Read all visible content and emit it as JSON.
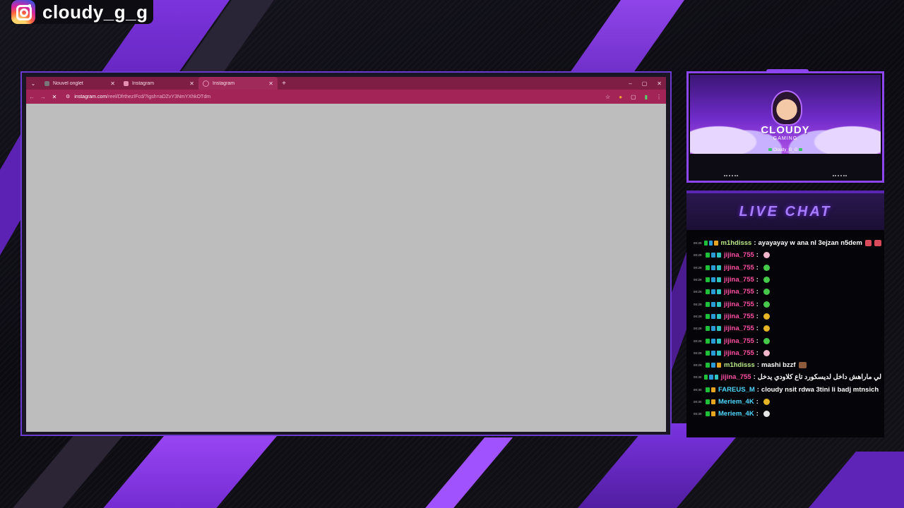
{
  "instagram": {
    "handle": "cloudy_g_g"
  },
  "browser": {
    "tabs": [
      {
        "label": "Nouvel onglet",
        "active": false
      },
      {
        "label": "Instagram",
        "active": false
      },
      {
        "label": "Instagram",
        "active": true
      }
    ],
    "new_tab_label": "+",
    "url_host": "instagram.com",
    "url_path": "/reel/DfrthezIFcd/?igsh=aDZvY3NmYXhkOTdm",
    "window_controls": [
      "–",
      "▢",
      "✕"
    ]
  },
  "webcam": {
    "logo_main": "CLOUDY",
    "logo_sub": "GAMING",
    "handle": "Cloudy_G_G"
  },
  "chat": {
    "title": "LIVE CHAT",
    "messages": [
      {
        "time": "00:29",
        "badges": [
          "g",
          "c",
          "y"
        ],
        "user": "m1hdisss",
        "color": "#b8e986",
        "text": "ayayayay w ana nl 3ejzan n5dem",
        "emotes": [
          "red",
          "red"
        ]
      },
      {
        "time": "00:29",
        "badges": [
          "g",
          "c",
          "t"
        ],
        "user": "jijina_755",
        "color": "#ff4fa3",
        "text": "",
        "emotes": [
          "pink"
        ]
      },
      {
        "time": "00:29",
        "badges": [
          "g",
          "c",
          "t"
        ],
        "user": "jijina_755",
        "color": "#ff4fa3",
        "text": "",
        "emotes": [
          "green"
        ]
      },
      {
        "time": "00:29",
        "badges": [
          "g",
          "c",
          "t"
        ],
        "user": "jijina_755",
        "color": "#ff4fa3",
        "text": "",
        "emotes": [
          "green"
        ]
      },
      {
        "time": "00:29",
        "badges": [
          "g",
          "c",
          "t"
        ],
        "user": "jijina_755",
        "color": "#ff4fa3",
        "text": "",
        "emotes": [
          "green"
        ]
      },
      {
        "time": "00:29",
        "badges": [
          "g",
          "c",
          "t"
        ],
        "user": "jijina_755",
        "color": "#ff4fa3",
        "text": "",
        "emotes": [
          "green"
        ]
      },
      {
        "time": "00:29",
        "badges": [
          "g",
          "c",
          "t"
        ],
        "user": "jijina_755",
        "color": "#ff4fa3",
        "text": "",
        "emotes": [
          "yellow"
        ]
      },
      {
        "time": "00:29",
        "badges": [
          "g",
          "c",
          "t"
        ],
        "user": "jijina_755",
        "color": "#ff4fa3",
        "text": "",
        "emotes": [
          "yellow"
        ]
      },
      {
        "time": "00:29",
        "badges": [
          "g",
          "c",
          "t"
        ],
        "user": "jijina_755",
        "color": "#ff4fa3",
        "text": "",
        "emotes": [
          "green"
        ]
      },
      {
        "time": "00:29",
        "badges": [
          "g",
          "c",
          "t"
        ],
        "user": "jijina_755",
        "color": "#ff4fa3",
        "text": "",
        "emotes": [
          "pink"
        ]
      },
      {
        "time": "00:29",
        "badges": [
          "g",
          "c",
          "y"
        ],
        "user": "m1hdisss",
        "color": "#b8e986",
        "text": "mashi bzzf",
        "emotes": [
          "brown"
        ]
      },
      {
        "time": "00:30",
        "badges": [
          "g",
          "c",
          "t"
        ],
        "user": "jijina_755",
        "color": "#ff4fa3",
        "text": "لي ماراهش داخل لديسكورد تاع كلاودي يدخل",
        "emotes": []
      },
      {
        "time": "00:30",
        "badges": [
          "g",
          "y"
        ],
        "user": "FAREUS_M",
        "color": "#4fd8ff",
        "text": "cloudy nsit rdwa 3tini li badj mtnsich",
        "emotes": []
      },
      {
        "time": "00:30",
        "badges": [
          "g",
          "y"
        ],
        "user": "Meriem_4K",
        "color": "#4fd8ff",
        "text": "",
        "emotes": [
          "yellow"
        ]
      },
      {
        "time": "00:30",
        "badges": [
          "g",
          "y"
        ],
        "user": "Meriem_4K",
        "color": "#4fd8ff",
        "text": "",
        "emotes": [
          "white"
        ]
      }
    ]
  },
  "colors": {
    "accent_purple": "#8d45f0",
    "browser_tabbar": "#7e1e45",
    "browser_addrbar": "#a32457",
    "viewport_gray": "#bdbdbd"
  }
}
